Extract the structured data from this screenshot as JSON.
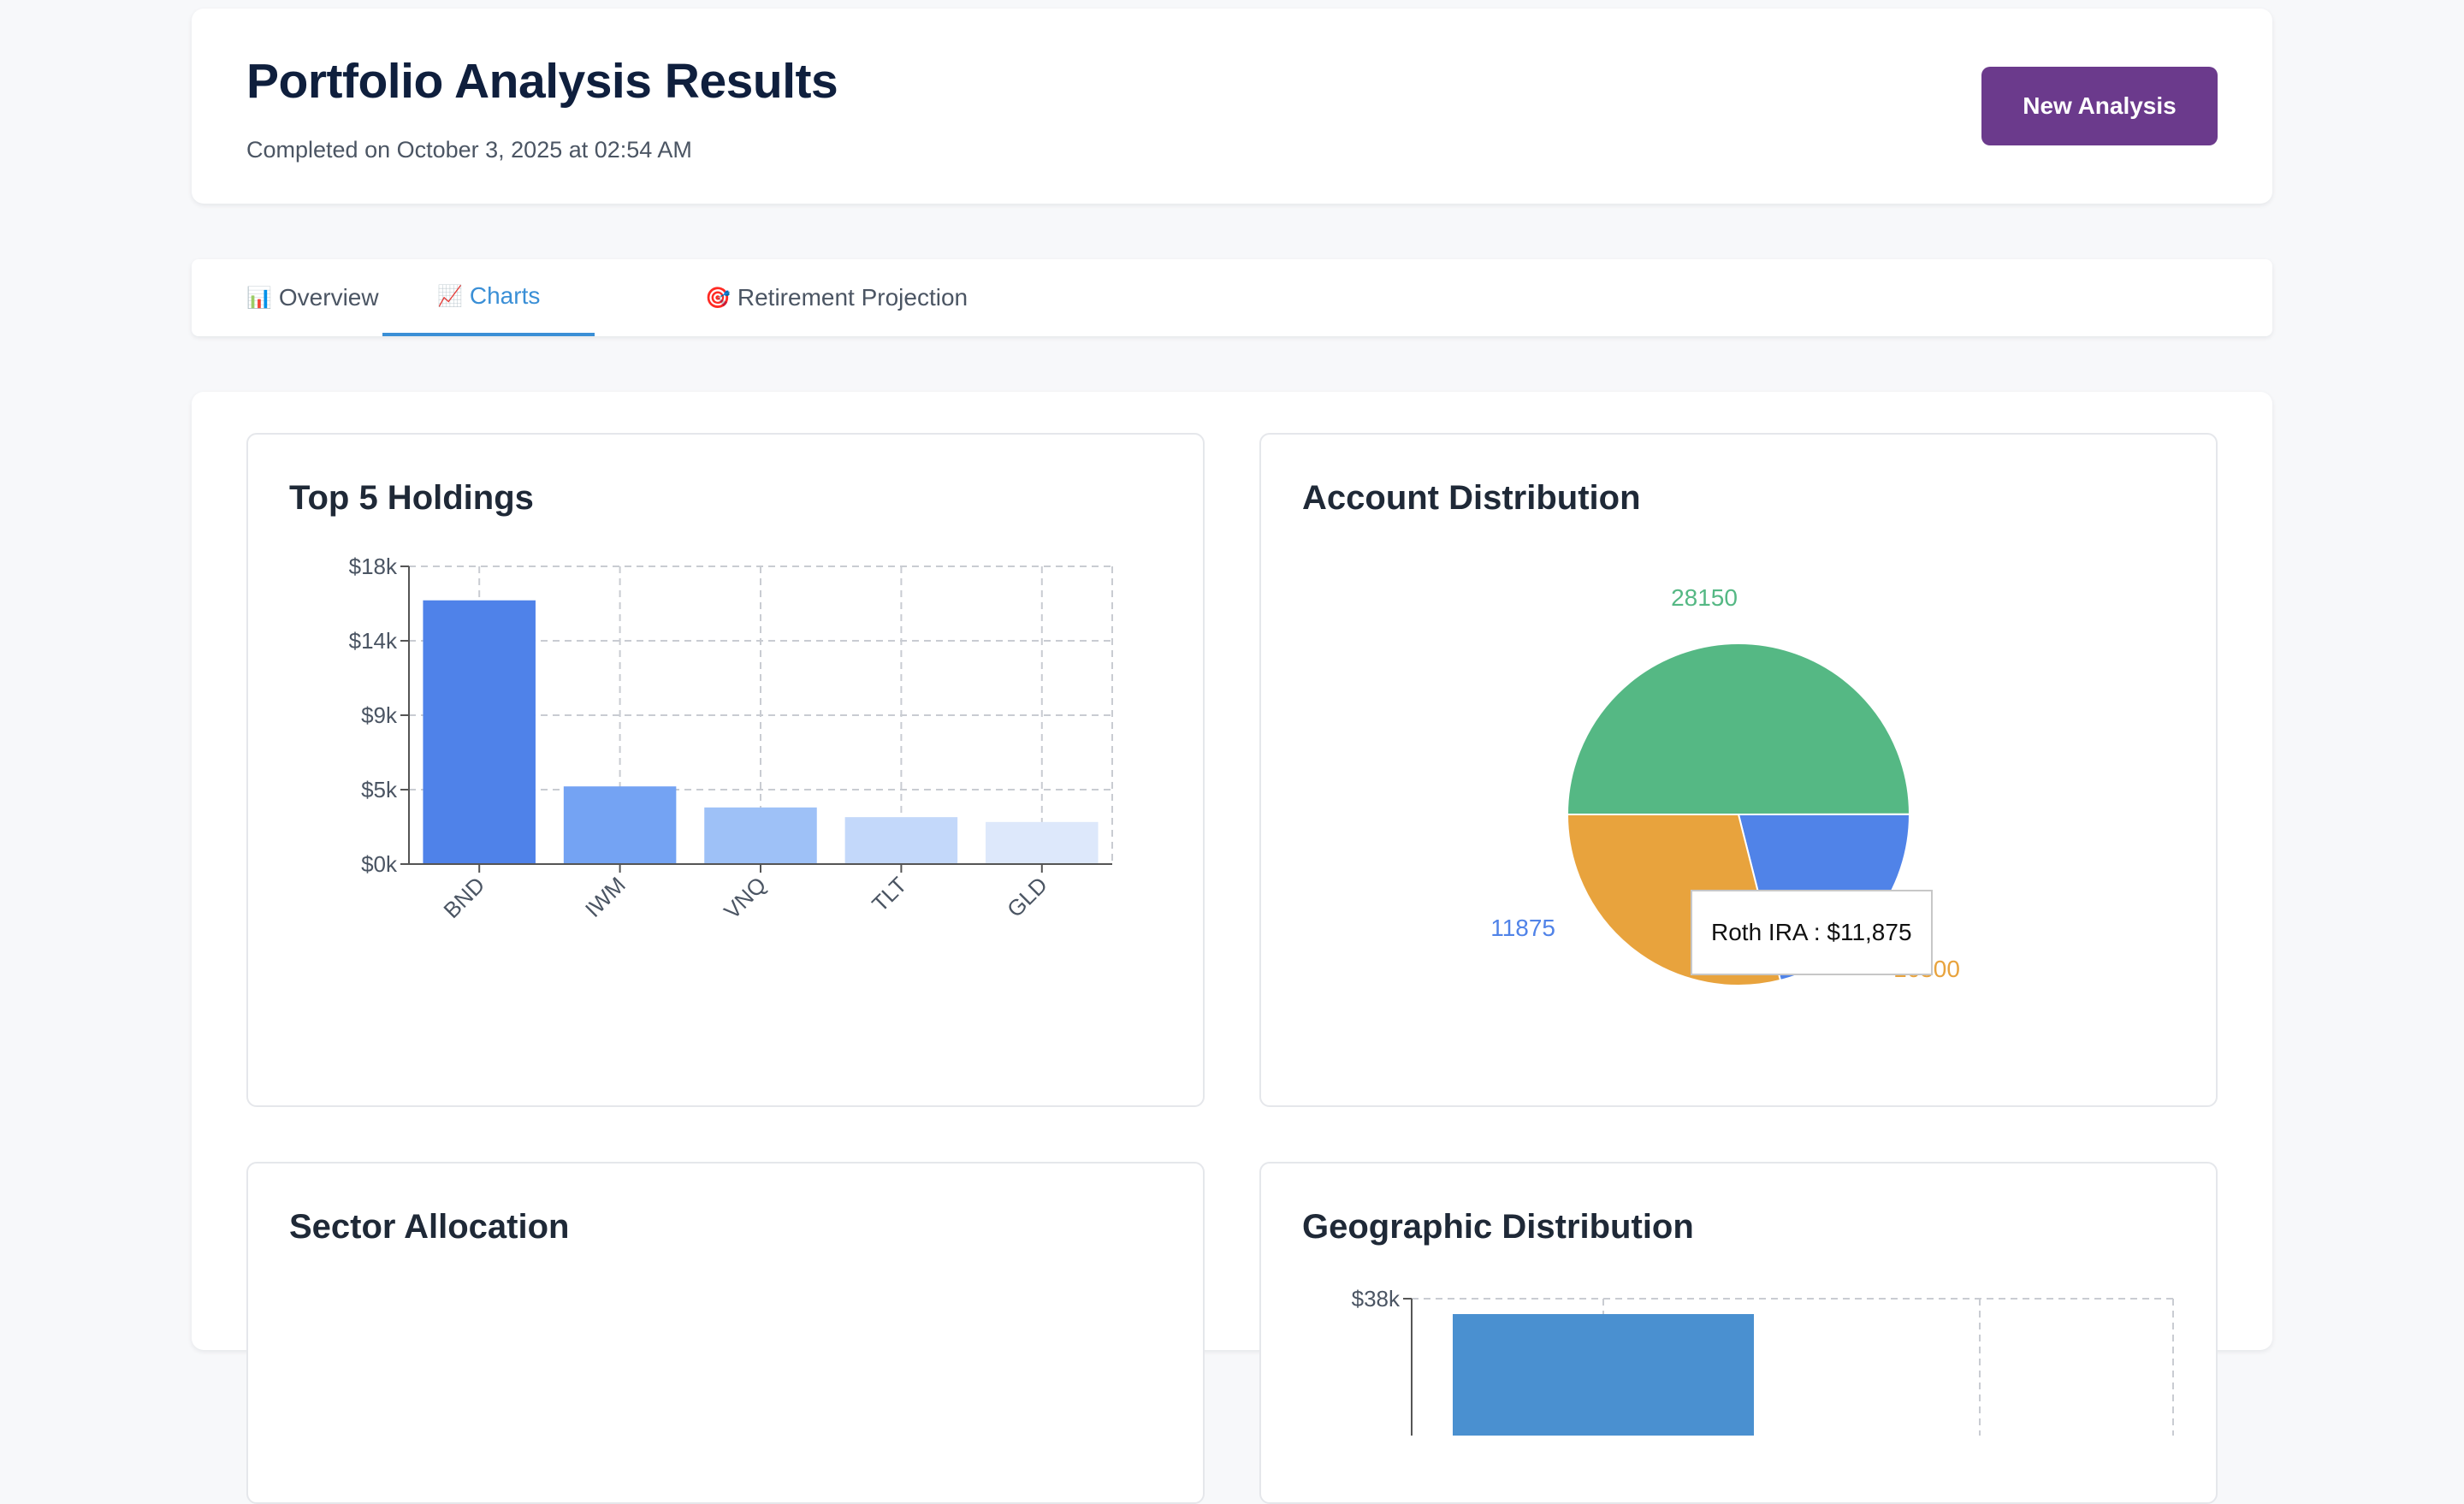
{
  "header": {
    "title": "Portfolio Analysis Results",
    "subtitle": "Completed on October 3, 2025 at 02:54 AM",
    "new_analysis_label": "New Analysis"
  },
  "tabs": [
    {
      "icon": "📊",
      "icon_name": "bar-chart-icon",
      "label": "Overview",
      "active": false
    },
    {
      "icon": "📈",
      "icon_name": "line-chart-icon",
      "label": "Charts",
      "active": true
    },
    {
      "icon": "🎯",
      "icon_name": "target-icon",
      "label": "Retirement Projection",
      "active": false
    }
  ],
  "colors": {
    "accent": "#3a8fd6",
    "brand_button": "#6b3a8c",
    "title_text": "#0f1f3d"
  },
  "panels": {
    "holdings_title": "Top 5 Holdings",
    "accounts_title": "Account Distribution",
    "sector_title": "Sector Allocation",
    "geo_title": "Geographic Distribution"
  },
  "tooltip": {
    "text": "Roth IRA : $11,875"
  },
  "chart_data": [
    {
      "type": "bar",
      "title": "Top 5 Holdings",
      "categories": [
        "BND",
        "IWM",
        "VNQ",
        "TLT",
        "GLD"
      ],
      "values": [
        16300,
        4800,
        3500,
        2900,
        2600
      ],
      "ylim": [
        0,
        18400
      ],
      "yticks": [
        0,
        4600,
        9200,
        13800,
        18400
      ],
      "ytick_labels": [
        "$0k",
        "$5k",
        "$9k",
        "$14k",
        "$18k"
      ],
      "bar_colors": [
        "#4f82e9",
        "#74a3f3",
        "#9ec1f7",
        "#c3d8fa",
        "#dde8fb"
      ],
      "grid": true
    },
    {
      "type": "pie",
      "title": "Account Distribution",
      "slices": [
        {
          "label": "28150",
          "value": 28150,
          "color": "#55b884"
        },
        {
          "label": "11875",
          "value": 11875,
          "color": "#5083e8",
          "name": "Roth IRA"
        },
        {
          "label": "16300",
          "value": 16300,
          "color": "#e8a33d"
        }
      ]
    },
    {
      "type": "bar",
      "title": "Geographic Distribution",
      "ytick_labels": [
        "$38k"
      ],
      "values": [
        38000
      ],
      "bar_colors": [
        "#4a90d0"
      ],
      "grid": true
    }
  ]
}
